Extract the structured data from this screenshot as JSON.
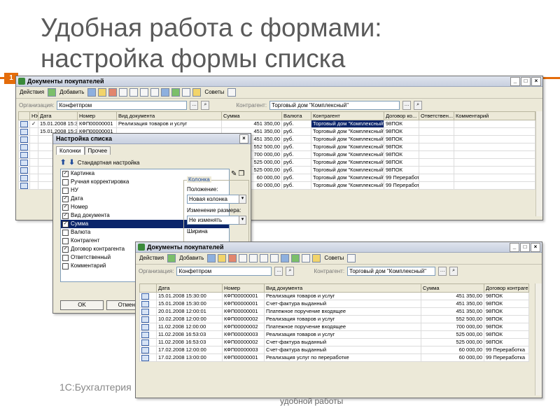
{
  "slide": {
    "title_line1": "Удобная работа с формами:",
    "title_line2": "настройка формы списка",
    "slide_number": "1",
    "footer_left": "1С:Бухгалтерия",
    "footer_center": "удобной работы"
  },
  "toolbar": {
    "actions": "Действия",
    "add": "Добавить",
    "settings": "Советы"
  },
  "filter": {
    "org_label": "Организация:",
    "org_value": "Конфетпром",
    "contractor_label": "Контрагент:",
    "contractor_value": "Торговый дом \"Комплексный\""
  },
  "back_window": {
    "title": "Документы покупателей",
    "headers": [
      "",
      "НУ",
      "Дата",
      "Номер",
      "Вид документа",
      "Сумма",
      "Валюта",
      "Контрагент",
      "Договор ко...",
      "Ответствен...",
      "Комментарий"
    ],
    "rows": [
      {
        "nu": "✓",
        "date": "15.01.2008 15:30:00",
        "num": "КФП00000001",
        "kind": "Реализация товаров и услуг",
        "sum": "451 350,00",
        "cur": "руб.",
        "contr": "Торговый дом \"Комплексный\"",
        "dog": "98ПОК"
      },
      {
        "nu": "",
        "date": "15.01.2008 15:30:00",
        "num": "КФП00000001",
        "kind": "",
        "sum": "451 350,00",
        "cur": "руб.",
        "contr": "Торговый дом \"Комплексный\"",
        "dog": "98ПОК"
      },
      {
        "nu": "",
        "date": "",
        "num": "",
        "kind": "",
        "sum": "451 350,00",
        "cur": "руб.",
        "contr": "Торговый дом \"Комплексный\"",
        "dog": "98ПОК"
      },
      {
        "nu": "",
        "date": "",
        "num": "",
        "kind": "",
        "sum": "552 500,00",
        "cur": "руб.",
        "contr": "Торговый дом \"Комплексный\"",
        "dog": "98ПОК"
      },
      {
        "nu": "",
        "date": "",
        "num": "",
        "kind": "",
        "sum": "700 000,00",
        "cur": "руб.",
        "contr": "Торговый дом \"Комплексный\"",
        "dog": "98ПОК"
      },
      {
        "nu": "",
        "date": "",
        "num": "",
        "kind": "",
        "sum": "525 000,00",
        "cur": "руб.",
        "contr": "Торговый дом \"Комплексный\"",
        "dog": "98ПОК"
      },
      {
        "nu": "",
        "date": "",
        "num": "",
        "kind": "",
        "sum": "525 000,00",
        "cur": "руб.",
        "contr": "Торговый дом \"Комплексный\"",
        "dog": "98ПОК"
      },
      {
        "nu": "",
        "date": "",
        "num": "",
        "kind": "",
        "sum": "60 000,00",
        "cur": "руб.",
        "contr": "Торговый дом \"Комплексный\"",
        "dog": "99 Переработ..."
      },
      {
        "nu": "",
        "date": "",
        "num": "",
        "kind": "",
        "sum": "60 000,00",
        "cur": "руб.",
        "contr": "Торговый дом \"Комплексный\"",
        "dog": "99 Переработ..."
      }
    ]
  },
  "dialog": {
    "title": "Настройка списка",
    "tab_columns": "Колонки",
    "tab_other": "Прочее",
    "standard": "Стандартная настройка",
    "columns": [
      {
        "label": "Картинка",
        "checked": true
      },
      {
        "label": "Ручная корректировка",
        "checked": false
      },
      {
        "label": "НУ",
        "checked": false
      },
      {
        "label": "Дата",
        "checked": true
      },
      {
        "label": "Номер",
        "checked": true
      },
      {
        "label": "Вид документа",
        "checked": true
      },
      {
        "label": "Сумма",
        "checked": true
      },
      {
        "label": "Валюта",
        "checked": false
      },
      {
        "label": "Контрагент",
        "checked": false
      },
      {
        "label": "Договор контрагента",
        "checked": true
      },
      {
        "label": "Ответственный",
        "checked": false
      },
      {
        "label": "Комментарий",
        "checked": false
      }
    ],
    "group_title": "Колонка",
    "position_label": "Положение:",
    "position_value": "Новая колонка",
    "resize_label": "Изменение размера:",
    "resize_value": "Не изменять",
    "width_label": "Ширина",
    "ok": "OK",
    "cancel": "Отмена"
  },
  "front_window": {
    "title": "Документы покупателей",
    "headers": [
      "",
      "Дата",
      "Номер",
      "Вид документа",
      "Сумма",
      "Договор контраге..."
    ],
    "rows": [
      {
        "date": "15.01.2008 15:30:00",
        "num": "КФП00000001",
        "kind": "Реализация товаров и услуг",
        "sum": "451 350,00",
        "dog": "98ПОК"
      },
      {
        "date": "15.01.2008 15:30:00",
        "num": "КФП00000001",
        "kind": "Счет-фактура выданный",
        "sum": "451 350,00",
        "dog": "98ПОК"
      },
      {
        "date": "20.01.2008 12:00:01",
        "num": "КФП00000001",
        "kind": "Платежное поручение входящее",
        "sum": "451 350,00",
        "dog": "98ПОК"
      },
      {
        "date": "10.02.2008 12:00:00",
        "num": "КФП00000002",
        "kind": "Реализация товаров и услуг",
        "sum": "552 500,00",
        "dog": "98ПОК"
      },
      {
        "date": "11.02.2008 12:00:00",
        "num": "КФП00000002",
        "kind": "Платежное поручение входящее",
        "sum": "700 000,00",
        "dog": "98ПОК"
      },
      {
        "date": "11.02.2008 16:53:03",
        "num": "КФП00000003",
        "kind": "Реализация товаров и услуг",
        "sum": "525 000,00",
        "dog": "98ПОК"
      },
      {
        "date": "11.02.2008 16:53:03",
        "num": "КФП00000002",
        "kind": "Счет-фактура выданный",
        "sum": "525 000,00",
        "dog": "98ПОК"
      },
      {
        "date": "17.02.2008 12:00:00",
        "num": "КФП00000003",
        "kind": "Счет-фактура выданный",
        "sum": "60 000,00",
        "dog": "99 Переработка"
      },
      {
        "date": "17.02.2008 13:00:00",
        "num": "КФП00000001",
        "kind": "Реализация услуг по переработке",
        "sum": "60 000,00",
        "dog": "99 Переработка"
      }
    ]
  }
}
